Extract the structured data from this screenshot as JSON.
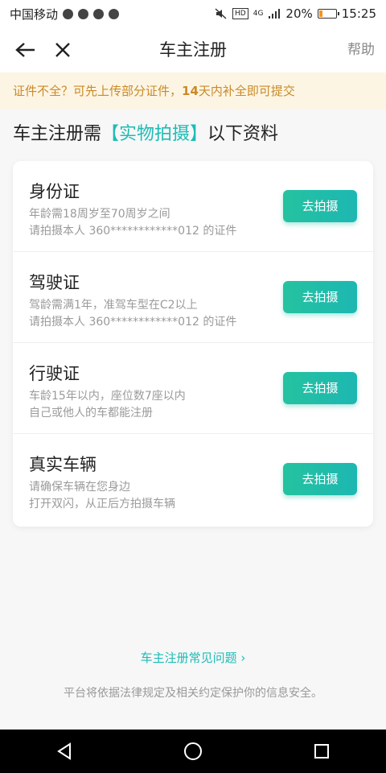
{
  "status_bar": {
    "carrier": "中国移动",
    "network": "4G",
    "hd": "HD",
    "battery": "20%",
    "battery_level": 0.2,
    "time": "15:25"
  },
  "header": {
    "title": "车主注册",
    "help": "帮助"
  },
  "notice": {
    "text_before": "证件不全？可先上传部分证件，",
    "bold": "14",
    "text_after": "天内补全即可提交"
  },
  "section": {
    "prefix": "车主注册需",
    "highlight": "【实物拍摄】",
    "suffix": "以下资料"
  },
  "items": [
    {
      "title": "身份证",
      "line1": "年龄需18周岁至70周岁之间",
      "line2": "请拍摄本人 360************012 的证件",
      "button": "去拍摄"
    },
    {
      "title": "驾驶证",
      "line1": "驾龄需满1年，准驾车型在C2以上",
      "line2": "请拍摄本人 360************012 的证件",
      "button": "去拍摄"
    },
    {
      "title": "行驶证",
      "line1": "车龄15年以内，座位数7座以内",
      "line2": "自己或他人的车都能注册",
      "button": "去拍摄"
    },
    {
      "title": "真实车辆",
      "line1": "请确保车辆在您身边",
      "line2": "打开双闪，从正后方拍摄车辆",
      "button": "去拍摄"
    }
  ],
  "faq": "车主注册常见问题 ›",
  "footer": "平台将依据法律规定及相关约定保护你的信息安全。",
  "colors": {
    "accent": "#1ebcb4",
    "notice_bg": "#fdf5e4",
    "notice_text": "#c98a28"
  }
}
